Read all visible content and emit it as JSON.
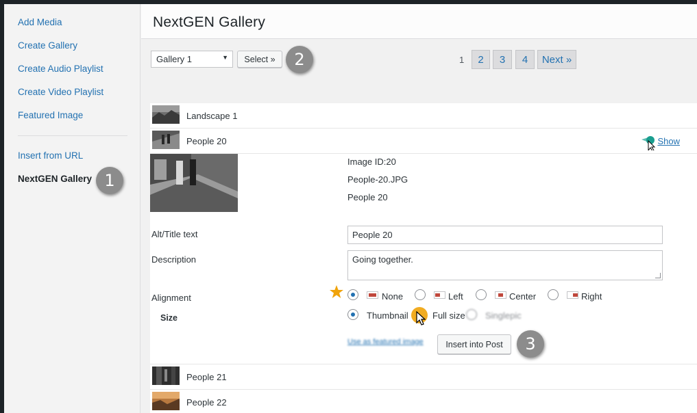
{
  "sidebar": {
    "links": [
      "Add Media",
      "Create Gallery",
      "Create Audio Playlist",
      "Create Video Playlist",
      "Featured Image"
    ],
    "insert_from_url": "Insert from URL",
    "active": "NextGEN Gallery"
  },
  "badges": [
    "1",
    "2",
    "3"
  ],
  "header": {
    "title": "NextGEN Gallery"
  },
  "toolbar": {
    "gallery_value": "Gallery 1",
    "select_label": "Select »"
  },
  "pager": {
    "current": "1",
    "pages": [
      "2",
      "3",
      "4"
    ],
    "next": "Next »"
  },
  "rows": [
    {
      "label": "Landscape 1"
    },
    {
      "label": "People 20",
      "action": "Show"
    },
    {
      "label": "People 21"
    },
    {
      "label": "People 22"
    }
  ],
  "detail": {
    "image_id": "Image ID:20",
    "filename": "People-20.JPG",
    "title": "People 20",
    "alt_label": "Alt/Title text",
    "alt_value": "People 20",
    "description_label": "Description",
    "description_value": "Going together.",
    "alignment_label": "Alignment",
    "alignment_options": [
      "None",
      "Left",
      "Center",
      "Right"
    ],
    "alignment_selected": "None",
    "size_label": "Size",
    "size_options": [
      "Thumbnail",
      "Full size",
      "Singlepic"
    ],
    "size_selected": "Thumbnail",
    "featured_link": "Use as featured image",
    "insert_label": "Insert into Post"
  },
  "colors": {
    "link": "#2271b1",
    "badge": "#8c8c8c",
    "highlight": "#f0a30a",
    "show_icon": "#1a9e8f"
  }
}
